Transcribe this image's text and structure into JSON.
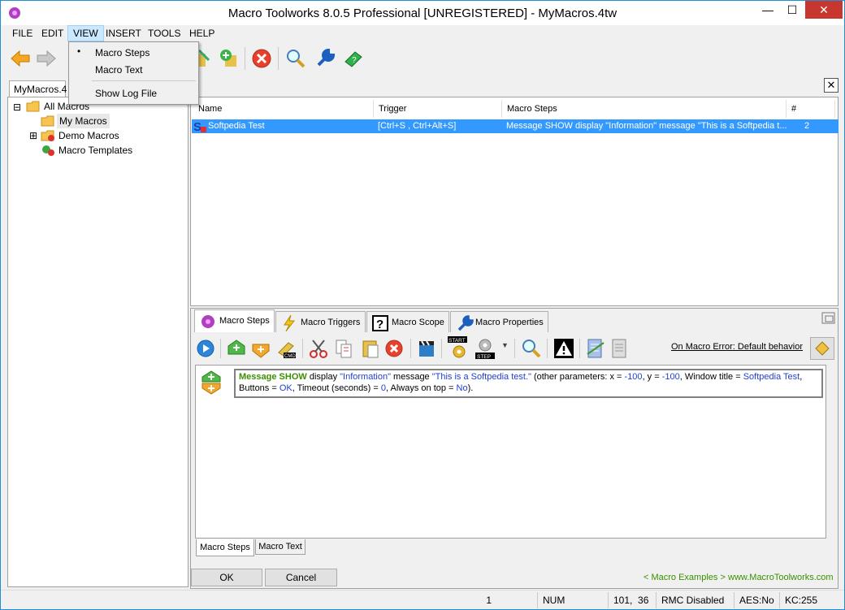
{
  "window": {
    "title": "Macro Toolworks 8.0.5 Professional [UNREGISTERED] - MyMacros.4tw",
    "minimize": "—",
    "maximize": "☐",
    "close": "✕"
  },
  "menu": [
    "FILE",
    "EDIT",
    "VIEW",
    "INSERT",
    "TOOLS",
    "HELP"
  ],
  "view_menu": {
    "items": [
      {
        "label": "Macro Steps",
        "checked": true
      },
      {
        "label": "Macro Text",
        "checked": false
      },
      {
        "label": "Show Log File",
        "checked": false
      }
    ],
    "bullet": "•"
  },
  "toolbar_icons": [
    "back-arrow-icon",
    "forward-arrow-icon",
    "new-macro-icon",
    "add-macro-icon",
    "delete-icon",
    "search-icon",
    "settings-wrench-icon",
    "help-book-icon"
  ],
  "tree": {
    "tab_label": "MyMacros.4",
    "close_glyph": "✕",
    "nodes": [
      {
        "label": "All Macros",
        "expander": "⊟"
      },
      {
        "label": "My Macros"
      },
      {
        "label": "Demo Macros",
        "expander": "⊞"
      },
      {
        "label": "Macro Templates"
      }
    ]
  },
  "grid": {
    "columns": [
      "Name",
      "Trigger",
      "Macro Steps",
      "#"
    ],
    "rows": [
      {
        "name": "Softpedia Test",
        "trigger": "[Ctrl+S , Ctrl+Alt+S]",
        "steps": "Message SHOW display \"Information\" message \"This is a Softpedia t...",
        "count": "2"
      }
    ]
  },
  "lower_tabs": [
    "Macro Steps",
    "Macro Triggers",
    "Macro Scope",
    "Macro Properties"
  ],
  "on_error_link": "On Macro Error: Default behavior",
  "step": {
    "cmd1": "Message",
    "cmd2": "SHOW",
    "t1": " display ",
    "q1": "\"Information\"",
    "t2": " message ",
    "q2": "\"This is a Softpedia test.\"",
    "t3": " (other parameters: x = ",
    "x": "-100",
    "t4": ", y = ",
    "y": "-100",
    "t5": ", Window title = ",
    "wt": "Softpedia Test",
    "t6": ",",
    "t7": "Buttons = ",
    "buttons": "OK",
    "t8": ", Timeout (seconds) = ",
    "timeout": "0",
    "t9": ", Always on top = ",
    "aot": "No",
    "t10": ")."
  },
  "bottom_tabs": [
    "Macro Steps",
    "Macro Text"
  ],
  "buttons": {
    "ok": "OK",
    "cancel": "Cancel"
  },
  "links": {
    "examples": "< Macro Examples >",
    "site": "www.MacroToolworks.com"
  },
  "status": {
    "count": "1",
    "num": "NUM",
    "pos": "101,  36",
    "rmc": "RMC Disabled",
    "aes": "AES:No",
    "kc": "KC:255"
  },
  "colors": {
    "selection": "#3399ff",
    "link_green": "#3c8f00",
    "value_blue": "#1f3fd6",
    "accent_border": "#1e8fd5"
  }
}
